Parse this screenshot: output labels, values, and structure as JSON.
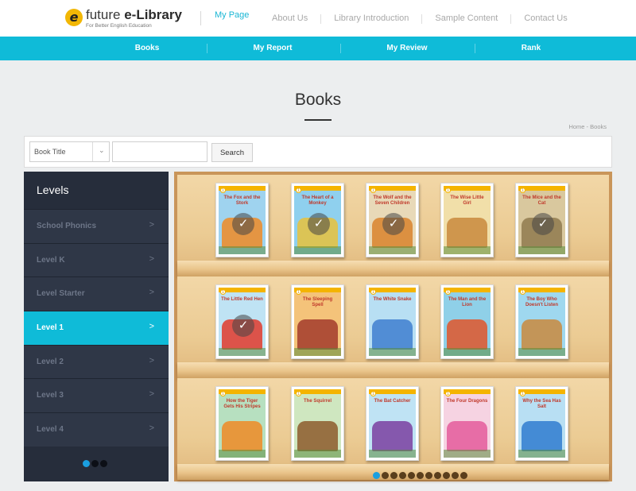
{
  "header": {
    "logo_mark": "e",
    "logo_name_plain": "future ",
    "logo_name_bold": "e-Library",
    "logo_tagline": "For Better English Education",
    "my_page": "My Page",
    "topnav": [
      "About Us",
      "Library Introduction",
      "Sample Content",
      "Contact Us"
    ]
  },
  "mainnav": [
    "Books",
    "My Report",
    "My Review",
    "Rank"
  ],
  "page": {
    "title": "Books",
    "breadcrumb": "Home - Books"
  },
  "search": {
    "select_value": "Book Title",
    "input_value": "",
    "button": "Search"
  },
  "sidebar": {
    "title": "Levels",
    "items": [
      {
        "label": "School Phonics",
        "active": false
      },
      {
        "label": "Level K",
        "active": false
      },
      {
        "label": "Level Starter",
        "active": false
      },
      {
        "label": "Level 1",
        "active": true
      },
      {
        "label": "Level 2",
        "active": false
      },
      {
        "label": "Level 3",
        "active": false
      },
      {
        "label": "Level 4",
        "active": false
      }
    ],
    "chevron": ">",
    "pager_count": 3,
    "pager_active": 0
  },
  "books": [
    {
      "title": "The Fox and the Stork",
      "read": true,
      "color": "#f08a24",
      "sky": "#9fd3ef"
    },
    {
      "title": "The Heart of a Monkey",
      "read": true,
      "color": "#e9c23b",
      "sky": "#8fd0ee"
    },
    {
      "title": "The Wolf and the Seven Children",
      "read": true,
      "color": "#d9822b",
      "sky": "#e8d9b8"
    },
    {
      "title": "The Wise Little Girl",
      "read": false,
      "color": "#c98a3d",
      "sky": "#f1dfa9"
    },
    {
      "title": "The Mice and the Cat",
      "read": true,
      "color": "#8f7a4d",
      "sky": "#d9c89e"
    },
    {
      "title": "The Little Red Hen",
      "read": true,
      "color": "#e1392b",
      "sky": "#bfe3f4"
    },
    {
      "title": "The Sleeping Spell",
      "read": false,
      "color": "#a23b2c",
      "sky": "#f4c37a"
    },
    {
      "title": "The White Snake",
      "read": false,
      "color": "#3e7fcf",
      "sky": "#b8dff3"
    },
    {
      "title": "The Man and the Lion",
      "read": false,
      "color": "#e0562a",
      "sky": "#8fd0e8"
    },
    {
      "title": "The Boy Who Doesn't Listen",
      "read": false,
      "color": "#c98a3d",
      "sky": "#9fd8ef"
    },
    {
      "title": "How the Tiger Gets His Stripes",
      "read": false,
      "color": "#f08a24",
      "sky": "#b7e0c0"
    },
    {
      "title": "The Squirrel",
      "read": false,
      "color": "#8d5a2b",
      "sky": "#cfe7c0"
    },
    {
      "title": "The Bat Catcher",
      "read": false,
      "color": "#7a3fa0",
      "sky": "#bfe3f4"
    },
    {
      "title": "The Four Dragons",
      "read": false,
      "color": "#e45a9b",
      "sky": "#f6d3e2"
    },
    {
      "title": "Why the Sea Has Salt",
      "read": false,
      "color": "#2f7ccf",
      "sky": "#b8dff3"
    }
  ],
  "shelf_pager": {
    "count": 11,
    "active": 0
  },
  "colors": {
    "accent": "#0fbbd8",
    "sidebar_bg": "#262d3b",
    "pager_active": "#1a9fe0"
  },
  "icons": {
    "read_check": "✓"
  }
}
